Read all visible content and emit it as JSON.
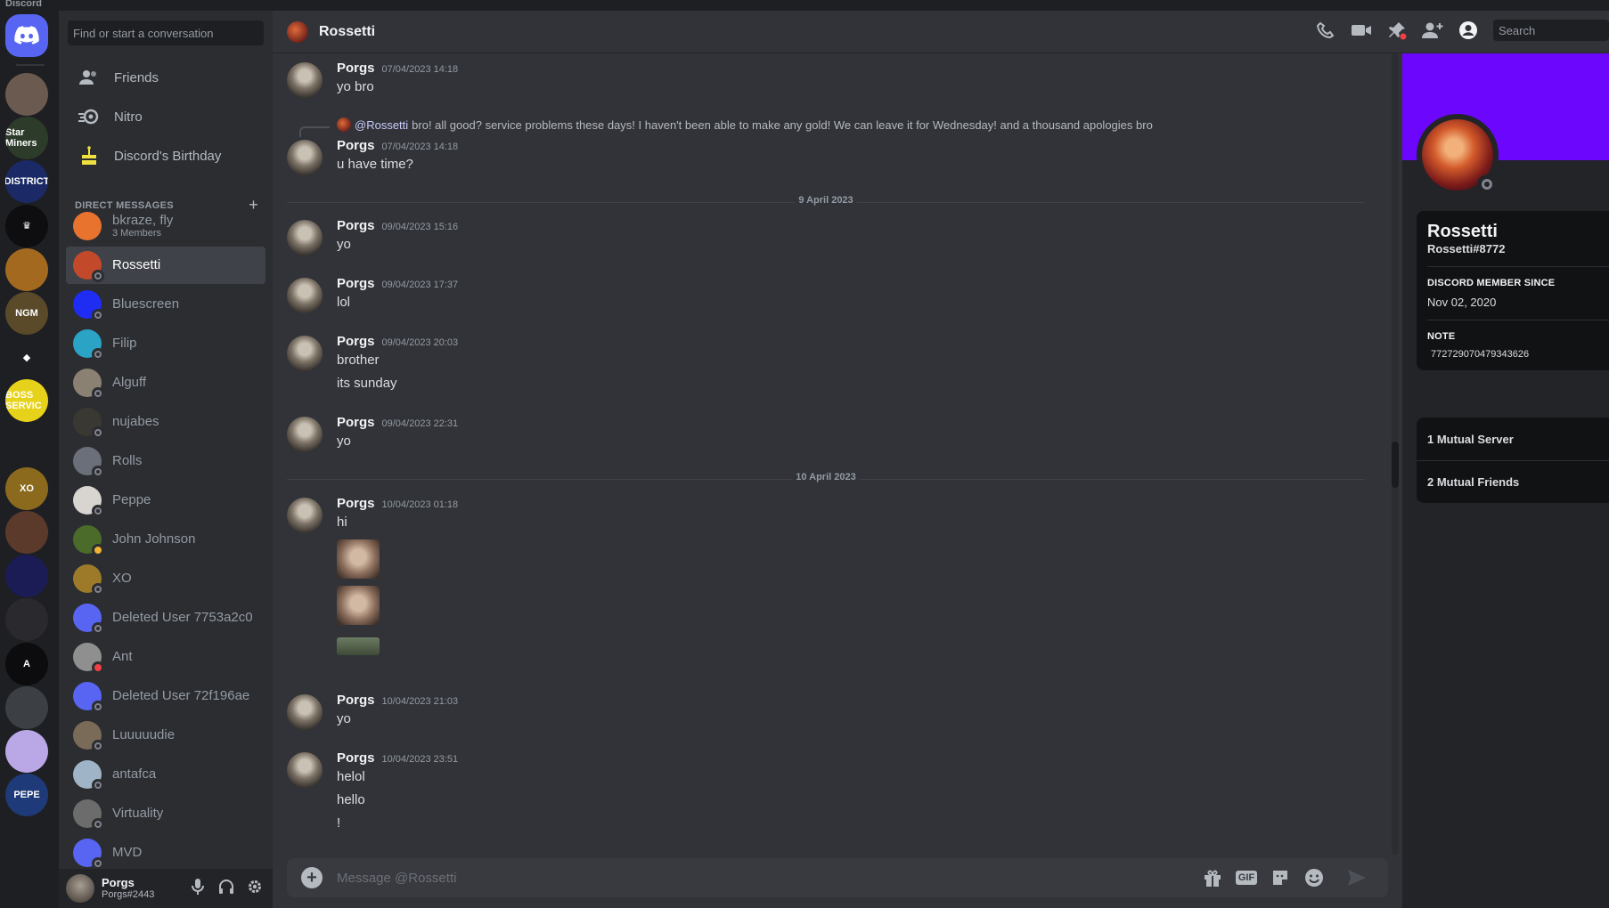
{
  "window": {
    "brand": "Discord"
  },
  "servers": [
    {
      "name": "Home",
      "label": "",
      "color": "#5865f2"
    },
    {
      "name": "server-1",
      "label": "",
      "color": "#6b5a4f"
    },
    {
      "name": "server-star-miners",
      "label": "Star Miners",
      "color": "#2d3b2a"
    },
    {
      "name": "server-district",
      "label": "DISTRICT",
      "color": "#1b2a66"
    },
    {
      "name": "server-crown",
      "label": "♛",
      "color": "#0e0e10"
    },
    {
      "name": "server-chest",
      "label": "",
      "color": "#a36a1f"
    },
    {
      "name": "server-ngms",
      "label": "NGM",
      "color": "#5a4a2a"
    },
    {
      "name": "server-diamond",
      "label": "◆",
      "color": "#1e1f22"
    },
    {
      "name": "server-boss",
      "label": "BOSS SERVIC",
      "color": "#e7d21b"
    },
    {
      "name": "server-chart",
      "label": "",
      "color": "#1e1f22"
    },
    {
      "name": "server-xo",
      "label": "XO",
      "color": "#8c6a1d"
    },
    {
      "name": "server-brown",
      "label": "",
      "color": "#5b3a2c"
    },
    {
      "name": "server-blue",
      "label": "",
      "color": "#1b1c55"
    },
    {
      "name": "server-dark",
      "label": "",
      "color": "#2a2a2e"
    },
    {
      "name": "server-a",
      "label": "A",
      "color": "#0c0c0e"
    },
    {
      "name": "server-shark",
      "label": "",
      "color": "#3c3f44"
    },
    {
      "name": "server-anime",
      "label": "",
      "color": "#b9a7e6"
    },
    {
      "name": "server-pepe",
      "label": "PEPE",
      "color": "#1e3a78"
    }
  ],
  "sidebar": {
    "search_placeholder": "Find or start a conversation",
    "nav": [
      {
        "label": "Friends",
        "icon": "friends-icon"
      },
      {
        "label": "Nitro",
        "icon": "nitro-icon"
      },
      {
        "label": "Discord's Birthday",
        "icon": "cake-icon"
      }
    ],
    "dm_header": "DIRECT MESSAGES",
    "dm_add": "+",
    "dms": [
      {
        "name": "bkraze, fly",
        "sub": "3 Members",
        "color": "#e8732f",
        "status": "",
        "active": false
      },
      {
        "name": "Rossetti",
        "sub": "",
        "color": "#c24a2a",
        "status": "offline",
        "active": true
      },
      {
        "name": "Bluescreen",
        "sub": "",
        "color": "#1f2cf2",
        "status": "offline",
        "active": false
      },
      {
        "name": "Filip",
        "sub": "",
        "color": "#2aa3c4",
        "status": "offline",
        "active": false
      },
      {
        "name": "Alguff",
        "sub": "",
        "color": "#8a8172",
        "status": "offline",
        "active": false
      },
      {
        "name": "nujabes",
        "sub": "",
        "color": "#3a3833",
        "status": "offline",
        "active": false
      },
      {
        "name": "Rolls",
        "sub": "",
        "color": "#6a6f7a",
        "status": "offline",
        "active": false
      },
      {
        "name": "Peppe",
        "sub": "",
        "color": "#d8d4cf",
        "status": "offline",
        "active": false
      },
      {
        "name": "John Johnson",
        "sub": "",
        "color": "#4b6b2a",
        "status": "idle",
        "active": false
      },
      {
        "name": "XO",
        "sub": "",
        "color": "#9c7a2a",
        "status": "offline",
        "active": false
      },
      {
        "name": "Deleted User 7753a2c0",
        "sub": "",
        "color": "#5865f2",
        "status": "offline",
        "active": false
      },
      {
        "name": "Ant",
        "sub": "",
        "color": "#8f8f8f",
        "status": "dnd",
        "active": false
      },
      {
        "name": "Deleted User 72f196ae",
        "sub": "",
        "color": "#5865f2",
        "status": "offline",
        "active": false
      },
      {
        "name": "Luuuuudie",
        "sub": "",
        "color": "#7a6a58",
        "status": "offline",
        "active": false
      },
      {
        "name": "antafca",
        "sub": "",
        "color": "#9fb4c6",
        "status": "offline",
        "active": false
      },
      {
        "name": "Virtuality",
        "sub": "",
        "color": "#6c6c6c",
        "status": "offline",
        "active": false
      },
      {
        "name": "MVD",
        "sub": "",
        "color": "#5865f2",
        "status": "offline",
        "active": false
      }
    ],
    "user": {
      "name": "Porgs",
      "tag": "Porgs#2443"
    }
  },
  "chat": {
    "title": "Rossetti",
    "search_placeholder": "Search",
    "composer_placeholder": "Message @Rossetti",
    "gif_label": "GIF",
    "messages": [
      {
        "author": "Porgs",
        "time": "07/04/2023 14:18",
        "lines": [
          "yo bro"
        ]
      },
      {
        "author": "Porgs",
        "time": "07/04/2023 14:18",
        "lines": [
          "u have time?"
        ],
        "reply_to": "@Rossetti",
        "reply_text": "bro! all good? service problems these days! I haven't been able to make any gold! We can leave it for Wednesday! and a thousand apologies bro"
      },
      {
        "author": "Porgs",
        "time": "09/04/2023 15:16",
        "lines": [
          "yo"
        ]
      },
      {
        "author": "Porgs",
        "time": "09/04/2023 17:37",
        "lines": [
          "lol"
        ]
      },
      {
        "author": "Porgs",
        "time": "09/04/2023 20:03",
        "lines": [
          "brother",
          "its sunday"
        ]
      },
      {
        "author": "Porgs",
        "time": "09/04/2023 22:31",
        "lines": [
          "yo"
        ]
      },
      {
        "author": "Porgs",
        "time": "10/04/2023 01:18",
        "lines": [
          "hi"
        ]
      },
      {
        "author": "Porgs",
        "time": "10/04/2023 21:03",
        "lines": [
          "yo"
        ]
      },
      {
        "author": "Porgs",
        "time": "10/04/2023 23:51",
        "lines": [
          "helol",
          "hello",
          "!"
        ]
      }
    ],
    "dividers": [
      "9 April 2023",
      "10 April 2023"
    ]
  },
  "profile": {
    "name": "Rossetti",
    "tag": "Rossetti#8772",
    "member_since_label": "DISCORD MEMBER SINCE",
    "member_since": "Nov 02, 2020",
    "note_label": "NOTE",
    "note": "772729070479343626",
    "mutual_servers": "1 Mutual Server",
    "mutual_friends": "2 Mutual Friends",
    "banner_color": "#6c06fc"
  }
}
